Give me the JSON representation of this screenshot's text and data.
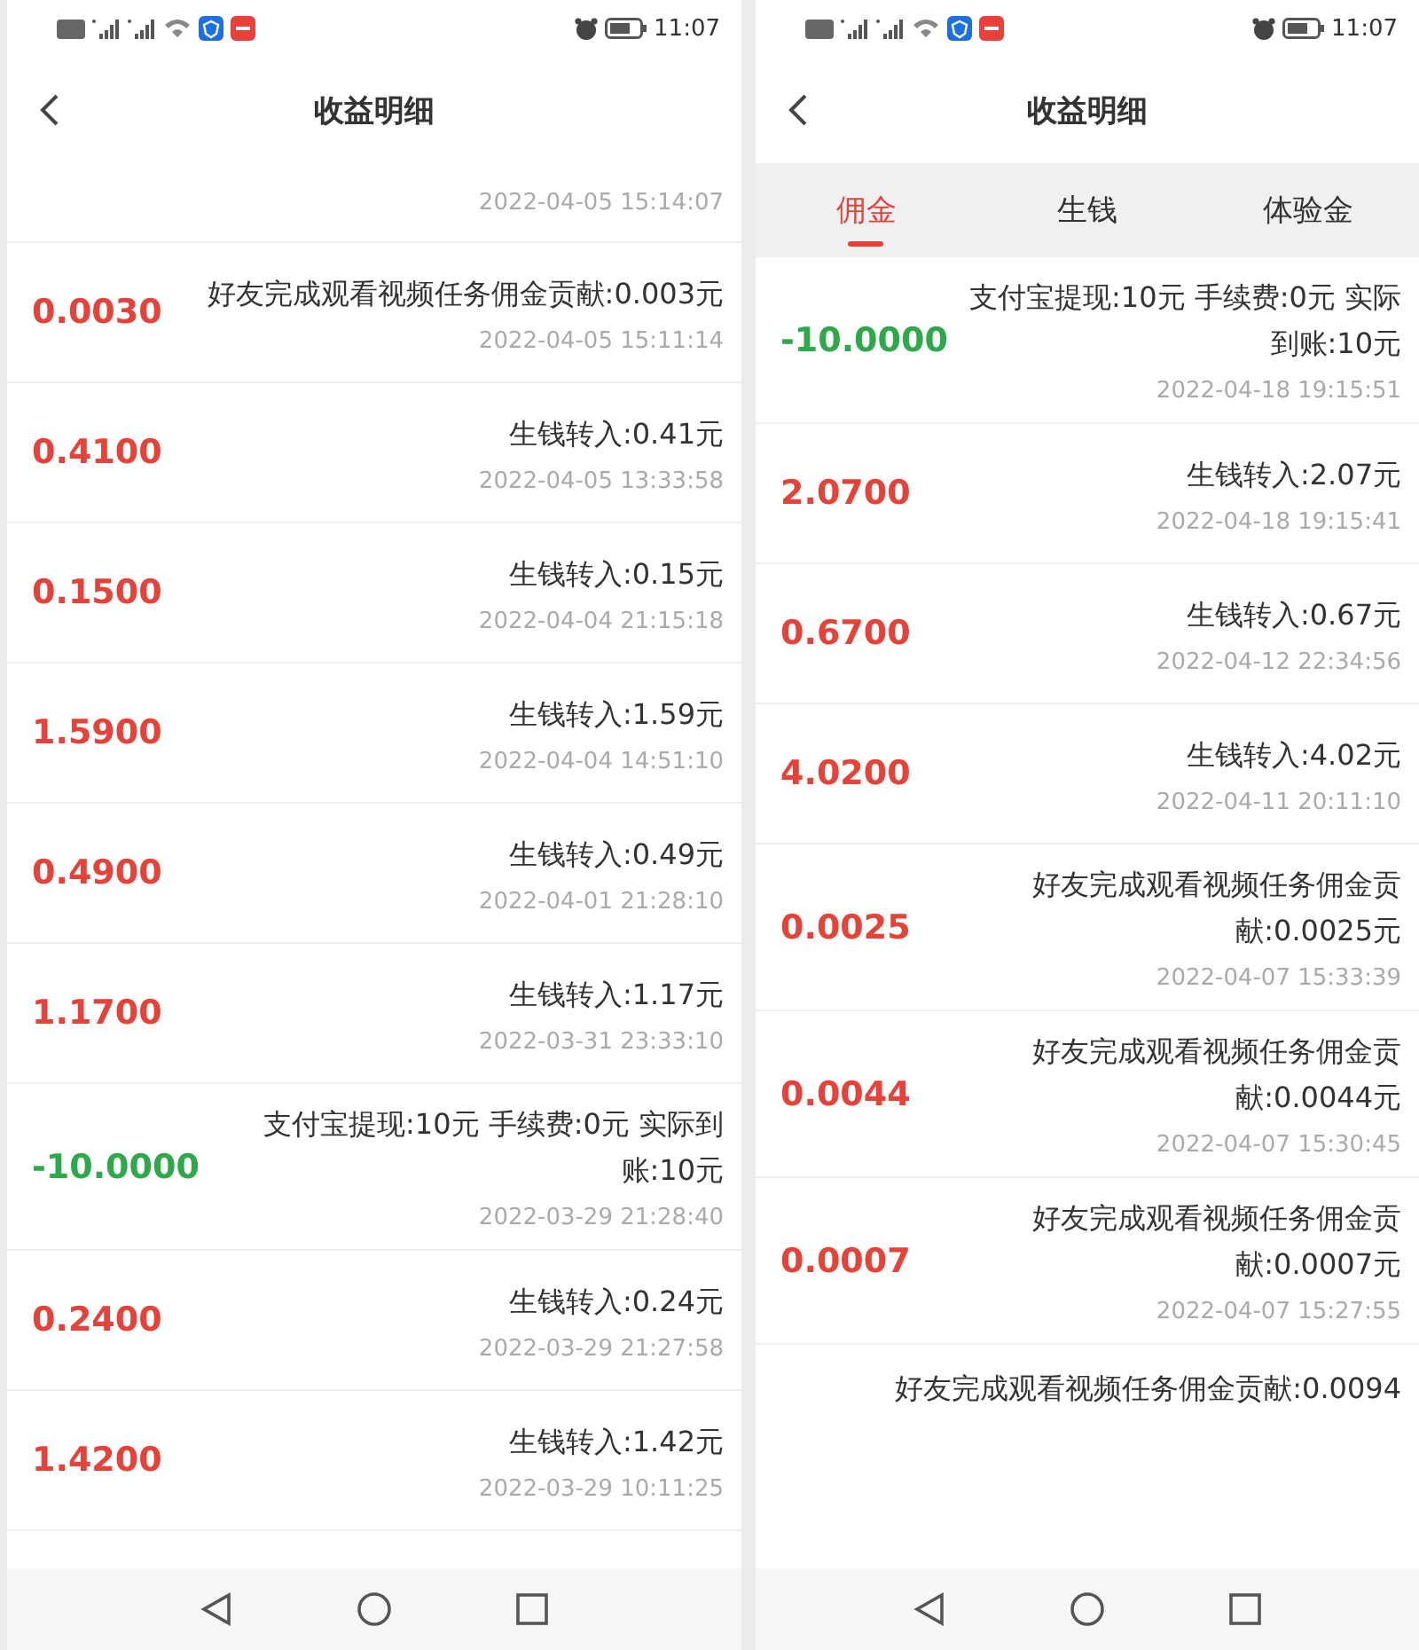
{
  "screens": [
    {
      "status_bar": {
        "time": "11:07"
      },
      "header": {
        "title": "收益明细"
      },
      "records": [
        {
          "kind": "partial",
          "date": "2022-04-05 15:14:07"
        },
        {
          "kind": "income",
          "amount": "0.0030",
          "description": "好友完成观看视频任务佣金贡献:0.003元",
          "date": "2022-04-05 15:11:14"
        },
        {
          "kind": "income",
          "amount": "0.4100",
          "description": "生钱转入:0.41元",
          "date": "2022-04-05 13:33:58"
        },
        {
          "kind": "income",
          "amount": "0.1500",
          "description": "生钱转入:0.15元",
          "date": "2022-04-04 21:15:18"
        },
        {
          "kind": "income",
          "amount": "1.5900",
          "description": "生钱转入:1.59元",
          "date": "2022-04-04 14:51:10"
        },
        {
          "kind": "income",
          "amount": "0.4900",
          "description": "生钱转入:0.49元",
          "date": "2022-04-01 21:28:10"
        },
        {
          "kind": "income",
          "amount": "1.1700",
          "description": "生钱转入:1.17元",
          "date": "2022-03-31 23:33:10"
        },
        {
          "kind": "withdrawal",
          "amount": "-10.0000",
          "description": "支付宝提现:10元 手续费:0元 实际到账:10元",
          "date": "2022-03-29 21:28:40"
        },
        {
          "kind": "income",
          "amount": "0.2400",
          "description": "生钱转入:0.24元",
          "date": "2022-03-29 21:27:58"
        },
        {
          "kind": "income",
          "amount": "1.4200",
          "description": "生钱转入:1.42元",
          "date": "2022-03-29 10:11:25"
        }
      ]
    },
    {
      "status_bar": {
        "time": "11:07"
      },
      "header": {
        "title": "收益明细"
      },
      "tabs": [
        {
          "label": "佣金",
          "selected": true
        },
        {
          "label": "生钱",
          "selected": false
        },
        {
          "label": "体验金",
          "selected": false
        }
      ],
      "records": [
        {
          "kind": "withdrawal",
          "amount": "-10.0000",
          "description": "支付宝提现:10元 手续费:0元 实际到账:10元",
          "date": "2022-04-18 19:15:51"
        },
        {
          "kind": "income",
          "amount": "2.0700",
          "description": "生钱转入:2.07元",
          "date": "2022-04-18 19:15:41"
        },
        {
          "kind": "income",
          "amount": "0.6700",
          "description": "生钱转入:0.67元",
          "date": "2022-04-12 22:34:56"
        },
        {
          "kind": "income",
          "amount": "4.0200",
          "description": "生钱转入:4.02元",
          "date": "2022-04-11 20:11:10"
        },
        {
          "kind": "income",
          "amount": "0.0025",
          "description": "好友完成观看视频任务佣金贡献:0.0025元",
          "date": "2022-04-07 15:33:39"
        },
        {
          "kind": "income",
          "amount": "0.0044",
          "description": "好友完成观看视频任务佣金贡献:0.0044元",
          "date": "2022-04-07 15:30:45"
        },
        {
          "kind": "income",
          "amount": "0.0007",
          "description": "好友完成观看视频任务佣金贡献:0.0007元",
          "date": "2022-04-07 15:27:55"
        },
        {
          "kind": "cut",
          "description": "好友完成观看视频任务佣金贡献:0.0094"
        }
      ]
    }
  ]
}
